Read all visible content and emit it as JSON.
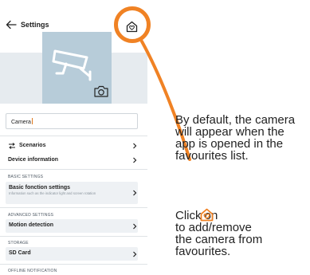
{
  "app": {
    "header": {
      "title": "Settings",
      "back_icon": "back-arrow-icon",
      "favourite_icon": "favourite-house-heart-icon"
    },
    "camera_preview": {
      "icon": "security-camera-icon",
      "photo_button_icon": "camera-photo-icon"
    },
    "name_field": {
      "value": "Camera"
    },
    "menu": [
      {
        "label": "Scenarios",
        "icon": "scenarios-icon"
      },
      {
        "label": "Device information"
      }
    ],
    "sections": {
      "basic": {
        "heading": "BASIC SETTINGS",
        "item_title": "Basic fonction settings",
        "item_subtitle": "Information such as the indicator light and screen rotation"
      },
      "advanced": {
        "heading": "ADVANCED SETTINGS",
        "item_title": "Motion detection"
      },
      "storage": {
        "heading": "STORAGE",
        "item_title": "SD Card"
      },
      "offline": {
        "heading": "OFFLINE NOTIFICATION"
      }
    }
  },
  "annotation": {
    "accent_color": "#f08224",
    "note1_lines": [
      "By default, the camera",
      "will appear when the",
      "app is opened in the",
      "favourites list."
    ],
    "note2_line1": "Click on",
    "note2_lines": [
      "to add/remove",
      "the camera from",
      "favourites."
    ]
  }
}
